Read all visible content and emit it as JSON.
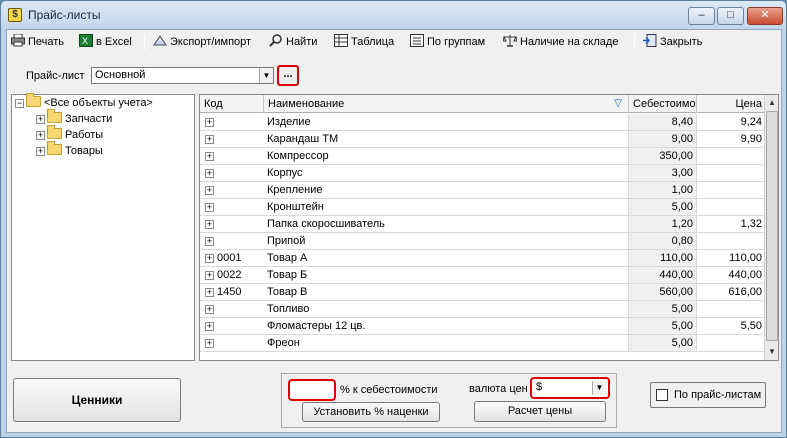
{
  "window": {
    "title": "Прайс-листы",
    "app_icon": "$"
  },
  "toolbar": {
    "print": "Печать",
    "excel": "в Excel",
    "export_import": "Экспорт/импорт",
    "find": "Найти",
    "table": "Таблица",
    "by_groups": "По группам",
    "in_stock": "Наличие на складе",
    "close": "Закрыть"
  },
  "pricelist": {
    "label": "Прайс-лист",
    "selected": "Основной",
    "more": "..."
  },
  "tree": {
    "root": "<Все объекты учета>",
    "children": [
      "Запчасти",
      "Работы",
      "Товары"
    ]
  },
  "grid": {
    "columns": {
      "code": "Код",
      "name": "Наименование",
      "cost": "Себестоимо",
      "price": "Цена"
    },
    "rows": [
      {
        "code": "",
        "name": "Изделие",
        "cost": "8,40",
        "price": "9,24"
      },
      {
        "code": "",
        "name": "Карандаш ТМ",
        "cost": "9,00",
        "price": "9,90"
      },
      {
        "code": "",
        "name": "Компрессор",
        "cost": "350,00",
        "price": ""
      },
      {
        "code": "",
        "name": "Корпус",
        "cost": "3,00",
        "price": ""
      },
      {
        "code": "",
        "name": "Крепление",
        "cost": "1,00",
        "price": ""
      },
      {
        "code": "",
        "name": "Кронштейн",
        "cost": "5,00",
        "price": ""
      },
      {
        "code": "",
        "name": "Папка скоросшиватель",
        "cost": "1,20",
        "price": "1,32"
      },
      {
        "code": "",
        "name": "Припой",
        "cost": "0,80",
        "price": ""
      },
      {
        "code": "0001",
        "name": "Товар А",
        "cost": "110,00",
        "price": "110,00"
      },
      {
        "code": "0022",
        "name": "Товар Б",
        "cost": "440,00",
        "price": "440,00"
      },
      {
        "code": "1450",
        "name": "Товар В",
        "cost": "560,00",
        "price": "616,00"
      },
      {
        "code": "",
        "name": "Топливо",
        "cost": "5,00",
        "price": ""
      },
      {
        "code": "",
        "name": "Фломастеры 12 цв.",
        "cost": "5,00",
        "price": "5,50"
      },
      {
        "code": "",
        "name": "Фреон",
        "cost": "5,00",
        "price": ""
      }
    ]
  },
  "bottom": {
    "tags_button": "Ценники",
    "markup_value": "",
    "markup_label": "% к себестоимости",
    "set_markup_button": "Установить % наценки",
    "currency_label": "валюта цен",
    "currency_value": "$",
    "calc_button": "Расчет цены",
    "by_pricelists": "По прайс-листам"
  },
  "colors": {
    "highlight": "#e00000",
    "title_bg": "#c9dcef",
    "close_btn": "#c74d33"
  }
}
